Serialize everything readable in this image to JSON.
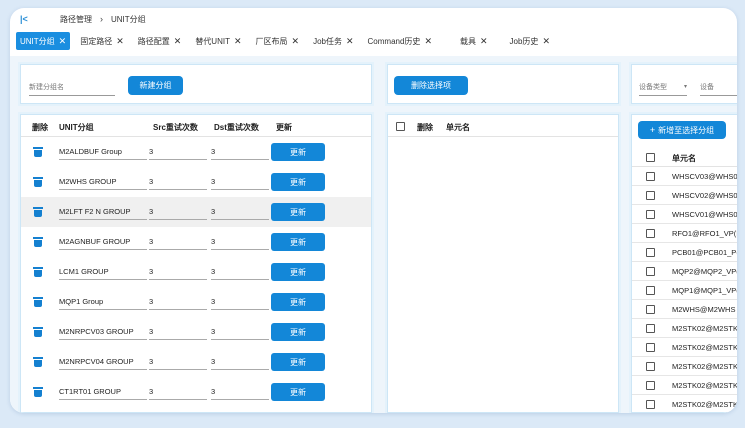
{
  "breadcrumb": {
    "root": "路径管理",
    "current": "UNIT分组"
  },
  "tabs": [
    {
      "label": "UNIT分组",
      "active": true
    },
    {
      "label": "固定路径"
    },
    {
      "label": "路径配置"
    },
    {
      "label": "替代UNIT"
    },
    {
      "label": "厂区布局"
    },
    {
      "label": "Job任务"
    },
    {
      "label": "Command历史"
    },
    {
      "label": "载具"
    },
    {
      "label": "Job历史"
    }
  ],
  "create": {
    "placeholder": "新建分组名",
    "button": "新建分组"
  },
  "groups_table": {
    "headers": {
      "delete": "删除",
      "name": "UNIT分组",
      "src": "Src重试次数",
      "dst": "Dst重试次数",
      "update": "更新"
    },
    "update_label": "更新",
    "rows": [
      {
        "name": "M2ALDBUF Group",
        "src": "3",
        "dst": "3"
      },
      {
        "name": "M2WHS GROUP",
        "src": "3",
        "dst": "3"
      },
      {
        "name": "M2LFT F2 N GROUP",
        "src": "3",
        "dst": "3"
      },
      {
        "name": "M2AGNBUF GROUP",
        "src": "3",
        "dst": "3"
      },
      {
        "name": "LCM1 GROUP",
        "src": "3",
        "dst": "3"
      },
      {
        "name": "MQP1 Group",
        "src": "3",
        "dst": "3"
      },
      {
        "name": "M2NRPCV03 GROUP",
        "src": "3",
        "dst": "3"
      },
      {
        "name": "M2NRPCV04 GROUP",
        "src": "3",
        "dst": "3"
      },
      {
        "name": "CT1RT01 GROUP",
        "src": "3",
        "dst": "3"
      }
    ]
  },
  "selected_panel": {
    "button": "删除选择项",
    "headers": {
      "delete": "删除",
      "unit": "单元名"
    }
  },
  "right_panel": {
    "device_type_label": "设备类型",
    "device_label": "设备",
    "add_button": "新增至选择分组",
    "header_unit": "单元名",
    "units": [
      "WHSCV03@WHS0",
      "WHSCV02@WHS0",
      "WHSCV01@WHS0",
      "RFO1@RFO1_VP(I",
      "PCB01@PCB01_P(",
      "MQP2@MQP2_VP(",
      "MQP1@MQP1_VP(",
      "M2WHS@M2WHS",
      "M2STK02@M2STK",
      "M2STK02@M2STK",
      "M2STK02@M2STK",
      "M2STK02@M2STK",
      "M2STK02@M2STK"
    ]
  },
  "colors": {
    "accent": "#1387d8",
    "page_bg": "#dbe9f7"
  }
}
